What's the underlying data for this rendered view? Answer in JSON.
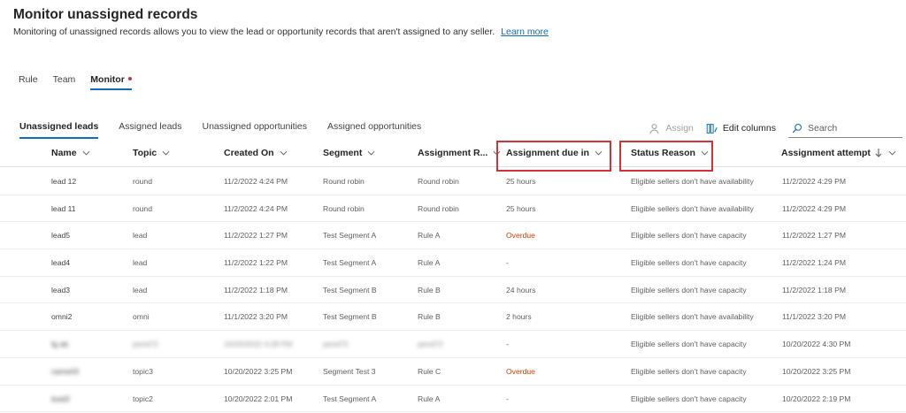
{
  "header": {
    "title": "Monitor unassigned records",
    "description": "Monitoring of unassigned records allows you to view the lead or opportunity records that aren't assigned to any seller.",
    "learn_more": "Learn more"
  },
  "top_tabs": [
    {
      "label": "Rule",
      "active": false
    },
    {
      "label": "Team",
      "active": false
    },
    {
      "label": "Monitor",
      "active": true
    }
  ],
  "sub_tabs": [
    {
      "label": "Unassigned leads",
      "active": true
    },
    {
      "label": "Assigned leads",
      "active": false
    },
    {
      "label": "Unassigned opportunities",
      "active": false
    },
    {
      "label": "Assigned opportunities",
      "active": false
    }
  ],
  "toolbar": {
    "assign_label": "Assign",
    "edit_columns_label": "Edit columns",
    "search_placeholder": "Search"
  },
  "columns": [
    {
      "label": "Name",
      "sort": "none"
    },
    {
      "label": "Topic",
      "sort": "none"
    },
    {
      "label": "Created On",
      "sort": "none"
    },
    {
      "label": "Segment",
      "sort": "none"
    },
    {
      "label": "Assignment R...",
      "sort": "none"
    },
    {
      "label": "Assignment due in",
      "sort": "none",
      "highlighted": true
    },
    {
      "label": "Status Reason",
      "sort": "none",
      "highlighted": true
    },
    {
      "label": "Assignment attempt",
      "sort": "descending"
    }
  ],
  "rows": [
    {
      "name": "lead 12",
      "topic": "round",
      "created_on": "11/2/2022 4:24 PM",
      "segment": "Round robin",
      "assignment_rule": "Round robin",
      "due_in": "25 hours",
      "status_reason": "Eligible sellers don't have availability",
      "assignment_attempt": "11/2/2022 4:29 PM",
      "overdue": false,
      "blurred": false
    },
    {
      "name": "lead 11",
      "topic": "round",
      "created_on": "11/2/2022 4:24 PM",
      "segment": "Round robin",
      "assignment_rule": "Round robin",
      "due_in": "25 hours",
      "status_reason": "Eligible sellers don't have availability",
      "assignment_attempt": "11/2/2022 4:29 PM",
      "overdue": false,
      "blurred": false
    },
    {
      "name": "lead5",
      "topic": "lead",
      "created_on": "11/2/2022 1:27 PM",
      "segment": "Test Segment A",
      "assignment_rule": "Rule A",
      "due_in": "Overdue",
      "status_reason": "Eligible sellers don't have capacity",
      "assignment_attempt": "11/2/2022 1:27 PM",
      "overdue": true,
      "blurred": false
    },
    {
      "name": "lead4",
      "topic": "lead",
      "created_on": "11/2/2022 1:22 PM",
      "segment": "Test Segment A",
      "assignment_rule": "Rule A",
      "due_in": "-",
      "status_reason": "Eligible sellers don't have capacity",
      "assignment_attempt": "11/2/2022 1:24 PM",
      "overdue": false,
      "blurred": false
    },
    {
      "name": "lead3",
      "topic": "lead",
      "created_on": "11/2/2022 1:18 PM",
      "segment": "Test Segment B",
      "assignment_rule": "Rule B",
      "due_in": "24 hours",
      "status_reason": "Eligible sellers don't have capacity",
      "assignment_attempt": "11/2/2022 1:18 PM",
      "overdue": false,
      "blurred": false
    },
    {
      "name": "omni2",
      "topic": "omni",
      "created_on": "11/1/2022 3:20 PM",
      "segment": "Test Segment B",
      "assignment_rule": "Rule B",
      "due_in": "2 hours",
      "status_reason": "Eligible sellers don't have availability",
      "assignment_attempt": "11/1/2022 3:20 PM",
      "overdue": false,
      "blurred": false
    },
    {
      "name": "fg ab",
      "topic": "pend72",
      "created_on": "10/20/2022 4:28 PM",
      "segment": "pend72",
      "assignment_rule": "pend72",
      "due_in": "-",
      "status_reason": "Eligible sellers don't have capacity",
      "assignment_attempt": "10/20/2022 4:30 PM",
      "overdue": false,
      "blurred": true
    },
    {
      "name": "name03",
      "topic": "topic3",
      "created_on": "10/20/2022 3:25 PM",
      "segment": "Segment Test 3",
      "assignment_rule": "Rule C",
      "due_in": "Overdue",
      "status_reason": "Eligible sellers don't have capacity",
      "assignment_attempt": "10/20/2022 3:25 PM",
      "overdue": true,
      "blurred": "name"
    },
    {
      "name": "lead2",
      "topic": "topic2",
      "created_on": "10/20/2022 2:01 PM",
      "segment": "Test Segment A",
      "assignment_rule": "Rule A",
      "due_in": "-",
      "status_reason": "Eligible sellers don't have capacity",
      "assignment_attempt": "10/20/2022 2:19 PM",
      "overdue": false,
      "blurred": "name"
    }
  ]
}
